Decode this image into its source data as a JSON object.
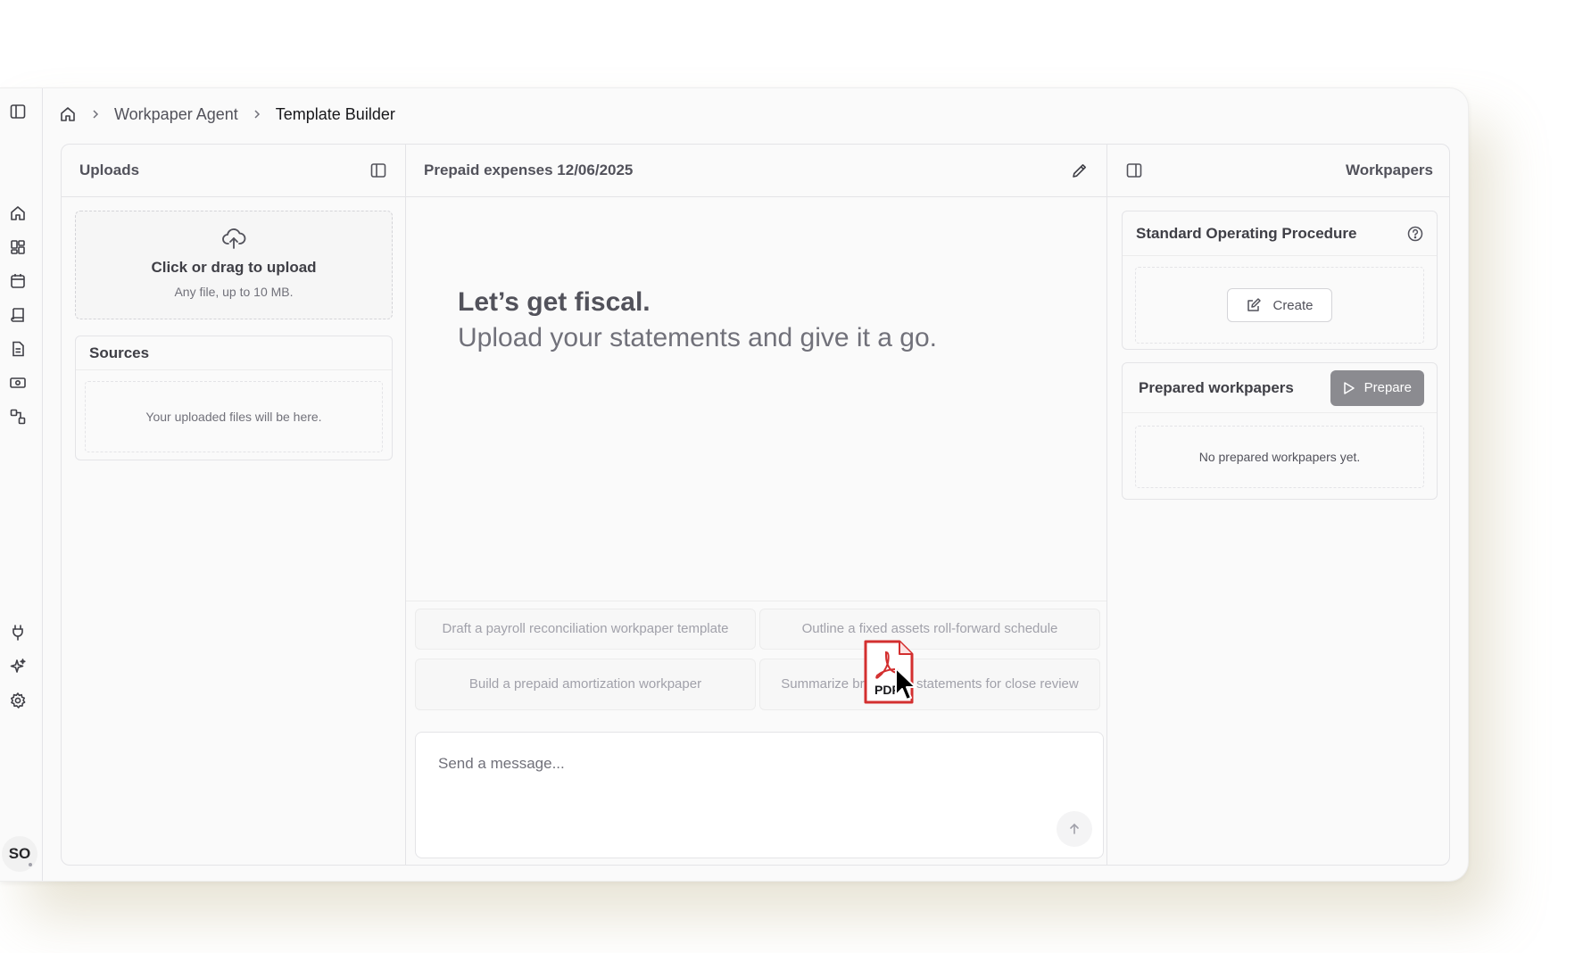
{
  "breadcrumb": {
    "items": [
      "Workpaper Agent",
      "Template Builder"
    ]
  },
  "rail": {
    "icons": [
      "sidebar-toggle-icon",
      "home-icon",
      "dashboard-icon",
      "calendar-icon",
      "book-icon",
      "document-icon",
      "money-icon",
      "workflow-icon",
      "plug-icon",
      "sparkles-icon",
      "settings-icon"
    ],
    "avatar_initials": "SO"
  },
  "uploads": {
    "title": "Uploads",
    "upload_title": "Click or drag to upload",
    "upload_hint": "Any file, up to 10 MB.",
    "sources_title": "Sources",
    "sources_empty": "Your uploaded files will be here."
  },
  "chat": {
    "title": "Prepaid expenses 12/06/2025",
    "hero_title": "Let’s get fiscal.",
    "hero_subtitle": "Upload your statements and give it a go.",
    "suggestions": [
      "Draft a payroll reconciliation workpaper template",
      "Outline a fixed assets roll-forward schedule",
      "Build a prepaid amortization workpaper",
      "Summarize brokerage statements for close review"
    ],
    "message_placeholder": "Send a message...",
    "drag_file_label": "PDF"
  },
  "workpapers": {
    "title": "Workpapers",
    "sop_title": "Standard Operating Procedure",
    "create_label": "Create",
    "prepared_title": "Prepared workpapers",
    "prepare_label": "Prepare",
    "prepared_empty": "No prepared workpapers yet."
  },
  "colors": {
    "accent_button": "#8b8b90",
    "pdf_red": "#d32f2f"
  }
}
